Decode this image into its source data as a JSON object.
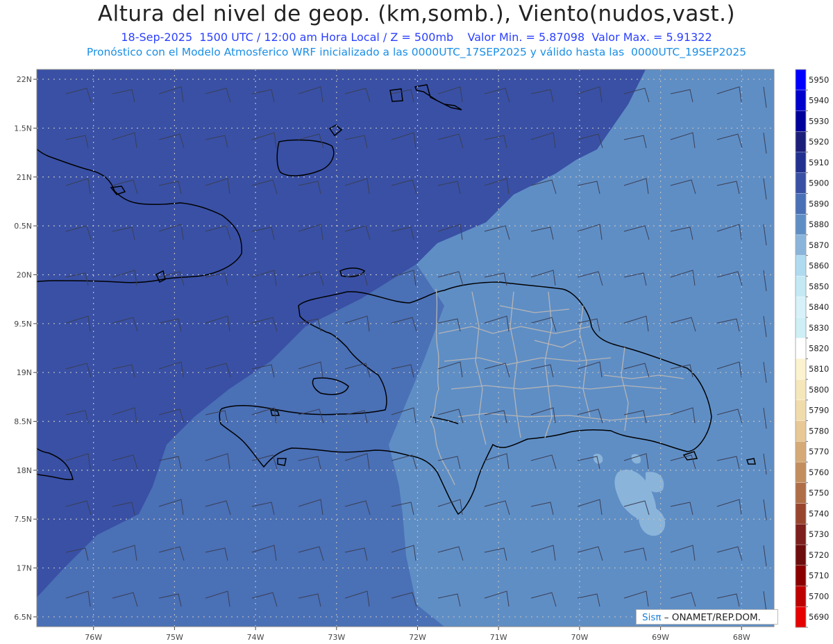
{
  "header": {
    "title": "Altura del nivel de geop. (km,somb.), Viento(nudos,vast.)",
    "line1": "18-Sep-2025  1500 UTC / 12:00 am Hora Local / Z = 500mb    Valor Min. = 5.87098  Valor Max. = 5.91322",
    "line2": "Pronóstico con el Modelo Atmosferico WRF inicializado a las 0000UTC_17SEP2025 y válido hasta las  0000UTC_19SEP2025"
  },
  "map": {
    "lat_range": [
      16.4,
      22.1
    ],
    "lon_range": [
      -76.7,
      -67.6
    ],
    "lat_labels": [
      "22N",
      "1.5N",
      "21N",
      "0.5N",
      "20N",
      "9.5N",
      "19N",
      "8.5N",
      "18N",
      "7.5N",
      "17N",
      "6.5N"
    ],
    "lat_values": [
      22,
      21.5,
      21,
      20.5,
      20,
      19.5,
      19,
      18.5,
      18,
      17.5,
      17,
      16.5
    ],
    "lon_labels": [
      "76W",
      "75W",
      "74W",
      "73W",
      "72W",
      "71W",
      "70W",
      "69W",
      "68W"
    ],
    "lon_values": [
      -76,
      -75,
      -74,
      -73,
      -72,
      -71,
      -70,
      -69,
      -68
    ],
    "colors": {
      "level_5910": "#3950a5",
      "level_5900": "#4a70b6",
      "level_5890": "#5f8ec5",
      "level_5880": "#8ab4da",
      "coast": "#000000",
      "borders": "#b5b5b5",
      "grid": "#bfbfbf"
    }
  },
  "colorbar": {
    "levels": [
      5950,
      5940,
      5930,
      5920,
      5910,
      5900,
      5890,
      5880,
      5870,
      5860,
      5850,
      5840,
      5830,
      5820,
      5810,
      5800,
      5790,
      5780,
      5770,
      5760,
      5750,
      5740,
      5730,
      5720,
      5710,
      5700,
      5690
    ],
    "colors": [
      "#0000ff",
      "#0000cc",
      "#00009a",
      "#1c1f7a",
      "#22318f",
      "#3950a5",
      "#4a70b6",
      "#5f8ec5",
      "#8ab4da",
      "#b0daf0",
      "#c4e9f4",
      "#d6f1f8",
      "#cdeff5",
      "#ffffff",
      "#fbf2cf",
      "#f6e7bb",
      "#f0dbab",
      "#e8c895",
      "#d5aa77",
      "#c38e5d",
      "#b06e46",
      "#99452e",
      "#7d1f1c",
      "#6e0d0d",
      "#8a0000",
      "#bd0000",
      "#e60000"
    ]
  },
  "credit": {
    "sis": "Sisπ",
    "rest": "– ONAMET/REP.DOM."
  }
}
